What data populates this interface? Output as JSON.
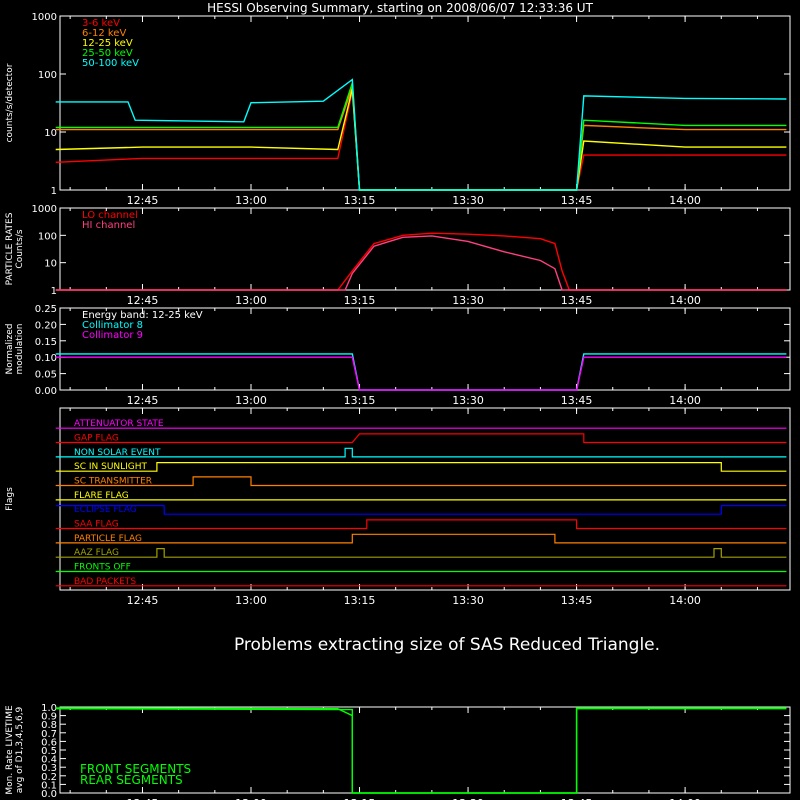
{
  "title": "HESSI Observing Summary, starting on 2008/06/07 12:33:36 UT",
  "message": "Problems extracting size of SAS Reduced Triangle.",
  "time_ticks": [
    "12:45",
    "13:00",
    "13:15",
    "13:30",
    "13:45",
    "14:00"
  ],
  "colors": {
    "background": "#000000",
    "axes": "#ffffff",
    "red": "#ff0000",
    "orange": "#ff8000",
    "yellow": "#ffff00",
    "green": "#00ff00",
    "cyan": "#00ffff",
    "magenta": "#ff00ff",
    "blue": "#0000ff",
    "pink": "#ff4080",
    "olive": "#a0a000"
  },
  "chart_data": [
    {
      "type": "line",
      "panel": "count-rates",
      "ylabel": "counts/s/detector",
      "ylog": true,
      "ylim": [
        1,
        1000
      ],
      "yticks": [
        "1",
        "10",
        "100",
        "1000"
      ],
      "x_unit": "UT",
      "series": [
        {
          "name": "3-6 keV",
          "color": "red",
          "points": [
            [
              "12:33",
              3
            ],
            [
              "12:45",
              3.5
            ],
            [
              "13:00",
              3.5
            ],
            [
              "13:12",
              3.5
            ],
            [
              "13:14",
              50
            ],
            [
              "13:15",
              1
            ],
            [
              "13:45",
              1
            ],
            [
              "13:46",
              4
            ],
            [
              "14:00",
              4
            ],
            [
              "14:14",
              4
            ]
          ]
        },
        {
          "name": "6-12 keV",
          "color": "orange",
          "points": [
            [
              "12:33",
              11
            ],
            [
              "12:45",
              11
            ],
            [
              "13:00",
              11
            ],
            [
              "13:12",
              11
            ],
            [
              "13:14",
              60
            ],
            [
              "13:15",
              1
            ],
            [
              "13:45",
              1
            ],
            [
              "13:46",
              13
            ],
            [
              "14:00",
              11
            ],
            [
              "14:14",
              11
            ]
          ]
        },
        {
          "name": "12-25 keV",
          "color": "yellow",
          "points": [
            [
              "12:33",
              5
            ],
            [
              "12:45",
              5.5
            ],
            [
              "13:00",
              5.5
            ],
            [
              "13:12",
              5
            ],
            [
              "13:14",
              55
            ],
            [
              "13:15",
              1
            ],
            [
              "13:45",
              1
            ],
            [
              "13:46",
              7
            ],
            [
              "14:00",
              5.5
            ],
            [
              "14:14",
              5.5
            ]
          ]
        },
        {
          "name": "25-50 keV",
          "color": "green",
          "points": [
            [
              "12:33",
              12
            ],
            [
              "12:45",
              12
            ],
            [
              "13:00",
              12
            ],
            [
              "13:12",
              12
            ],
            [
              "13:14",
              70
            ],
            [
              "13:15",
              1
            ],
            [
              "13:45",
              1
            ],
            [
              "13:46",
              16
            ],
            [
              "14:00",
              13
            ],
            [
              "14:14",
              13
            ]
          ]
        },
        {
          "name": "50-100 keV",
          "color": "cyan",
          "points": [
            [
              "12:33",
              33
            ],
            [
              "12:43",
              33
            ],
            [
              "12:44",
              16
            ],
            [
              "12:59",
              15
            ],
            [
              "13:00",
              32
            ],
            [
              "13:10",
              34
            ],
            [
              "13:14",
              80
            ],
            [
              "13:15",
              1
            ],
            [
              "13:45",
              1
            ],
            [
              "13:46",
              42
            ],
            [
              "14:00",
              38
            ],
            [
              "14:14",
              37
            ]
          ]
        }
      ]
    },
    {
      "type": "line",
      "panel": "particle-rates",
      "ylabel": [
        "PARTICLE RATES",
        "Counts/s"
      ],
      "ylog": true,
      "ylim": [
        1,
        1000
      ],
      "yticks": [
        "1",
        "10",
        "100",
        "1000"
      ],
      "series": [
        {
          "name": "LO channel",
          "color": "red",
          "points": [
            [
              "12:33",
              1
            ],
            [
              "13:12",
              1
            ],
            [
              "13:14",
              5
            ],
            [
              "13:17",
              50
            ],
            [
              "13:21",
              100
            ],
            [
              "13:25",
              120
            ],
            [
              "13:30",
              110
            ],
            [
              "13:35",
              95
            ],
            [
              "13:40",
              75
            ],
            [
              "13:42",
              50
            ],
            [
              "13:43",
              5
            ],
            [
              "13:44",
              1
            ],
            [
              "14:14",
              1
            ]
          ]
        },
        {
          "name": "HI channel",
          "color": "pink",
          "points": [
            [
              "12:33",
              1
            ],
            [
              "13:13",
              1
            ],
            [
              "13:14",
              4
            ],
            [
              "13:17",
              40
            ],
            [
              "13:21",
              85
            ],
            [
              "13:25",
              95
            ],
            [
              "13:30",
              60
            ],
            [
              "13:35",
              25
            ],
            [
              "13:40",
              12
            ],
            [
              "13:42",
              6
            ],
            [
              "13:43",
              1
            ],
            [
              "14:14",
              1
            ]
          ]
        }
      ]
    },
    {
      "type": "line",
      "panel": "modulation",
      "ylabel": [
        "Normalized",
        "modulation"
      ],
      "ylim": [
        0,
        0.25
      ],
      "yticks": [
        "0.00",
        "0.05",
        "0.10",
        "0.15",
        "0.20",
        "0.25"
      ],
      "annotation": "Energy band: 12-25 keV",
      "series": [
        {
          "name": "Collimator 8",
          "color": "cyan",
          "points": [
            [
              "12:33",
              0.11
            ],
            [
              "13:14",
              0.11
            ],
            [
              "13:15",
              0.0
            ],
            [
              "13:45",
              0.0
            ],
            [
              "13:46",
              0.11
            ],
            [
              "14:14",
              0.11
            ]
          ]
        },
        {
          "name": "Collimator 9",
          "color": "magenta",
          "points": [
            [
              "12:33",
              0.1
            ],
            [
              "13:14",
              0.1
            ],
            [
              "13:15",
              0.0
            ],
            [
              "13:45",
              0.0
            ],
            [
              "13:46",
              0.1
            ],
            [
              "14:14",
              0.1
            ]
          ]
        }
      ]
    },
    {
      "type": "line",
      "panel": "flags",
      "ylabel": "Flags",
      "series": [
        {
          "name": "ATTENUATOR STATE",
          "color": "magenta",
          "points": [
            [
              "12:33",
              0
            ],
            [
              "14:14",
              0
            ]
          ]
        },
        {
          "name": "GAP FLAG",
          "color": "red",
          "points": [
            [
              "12:33",
              0
            ],
            [
              "13:14",
              0
            ],
            [
              "13:15",
              1
            ],
            [
              "13:46",
              1
            ],
            [
              "13:46",
              0
            ],
            [
              "14:14",
              0
            ]
          ]
        },
        {
          "name": "NON SOLAR EVENT",
          "color": "cyan",
          "points": [
            [
              "12:33",
              0
            ],
            [
              "13:13",
              0
            ],
            [
              "13:13",
              1
            ],
            [
              "13:14",
              1
            ],
            [
              "13:14",
              0
            ],
            [
              "14:14",
              0
            ]
          ]
        },
        {
          "name": "SC IN SUNLIGHT",
          "color": "yellow",
          "points": [
            [
              "12:33",
              0
            ],
            [
              "12:47",
              0
            ],
            [
              "12:47",
              1
            ],
            [
              "14:05",
              1
            ],
            [
              "14:05",
              0
            ],
            [
              "14:14",
              0
            ]
          ]
        },
        {
          "name": "SC TRANSMITTER",
          "color": "orange",
          "points": [
            [
              "12:33",
              0
            ],
            [
              "12:52",
              0
            ],
            [
              "12:52",
              1
            ],
            [
              "13:00",
              1
            ],
            [
              "13:00",
              0
            ],
            [
              "14:14",
              0
            ]
          ]
        },
        {
          "name": "FLARE FLAG",
          "color": "yellow",
          "points": [
            [
              "12:33",
              0
            ],
            [
              "14:14",
              0
            ]
          ]
        },
        {
          "name": "ECLIPSE FLAG",
          "color": "blue",
          "points": [
            [
              "12:33",
              1
            ],
            [
              "12:48",
              1
            ],
            [
              "12:48",
              0
            ],
            [
              "14:05",
              0
            ],
            [
              "14:05",
              1
            ],
            [
              "14:14",
              1
            ]
          ]
        },
        {
          "name": "SAA FLAG",
          "color": "red",
          "points": [
            [
              "12:33",
              0
            ],
            [
              "13:16",
              0
            ],
            [
              "13:16",
              1
            ],
            [
              "13:45",
              1
            ],
            [
              "13:45",
              0
            ],
            [
              "14:14",
              0
            ]
          ]
        },
        {
          "name": "PARTICLE FLAG",
          "color": "orange",
          "points": [
            [
              "12:33",
              0
            ],
            [
              "13:14",
              0
            ],
            [
              "13:14",
              1
            ],
            [
              "13:42",
              1
            ],
            [
              "13:42",
              0
            ],
            [
              "14:14",
              0
            ]
          ]
        },
        {
          "name": "AAZ FLAG",
          "color": "olive",
          "points": [
            [
              "12:33",
              0
            ],
            [
              "12:47",
              0
            ],
            [
              "12:47",
              1
            ],
            [
              "12:48",
              1
            ],
            [
              "12:48",
              0
            ],
            [
              "14:04",
              0
            ],
            [
              "14:04",
              1
            ],
            [
              "14:05",
              1
            ],
            [
              "14:05",
              0
            ],
            [
              "14:14",
              0
            ]
          ]
        },
        {
          "name": "FRONTS OFF",
          "color": "green",
          "points": [
            [
              "12:33",
              0
            ],
            [
              "14:14",
              0
            ]
          ]
        },
        {
          "name": "BAD PACKETS",
          "color": "red",
          "points": [
            [
              "12:33",
              0
            ],
            [
              "14:14",
              0
            ]
          ]
        }
      ]
    },
    {
      "type": "line",
      "panel": "livetime",
      "ylabel": [
        "Mon. Rate LIVETIME",
        "avg of D1,3,4,5,6,9"
      ],
      "ylim": [
        0,
        1.0
      ],
      "yticks": [
        "0.0",
        "0.1",
        "0.2",
        "0.3",
        "0.4",
        "0.5",
        "0.6",
        "0.7",
        "0.8",
        "0.9",
        "1.0"
      ],
      "series": [
        {
          "name": "FRONT SEGMENTS",
          "color": "green",
          "points": [
            [
              "12:33",
              0.99
            ],
            [
              "13:12",
              0.98
            ],
            [
              "13:14",
              0.9
            ],
            [
              "13:14",
              0.0
            ],
            [
              "13:45",
              0.0
            ],
            [
              "13:45",
              0.99
            ],
            [
              "14:14",
              0.99
            ]
          ]
        },
        {
          "name": "REAR SEGMENTS",
          "color": "green",
          "points": [
            [
              "12:33",
              0.98
            ],
            [
              "13:14",
              0.97
            ],
            [
              "13:14",
              0.0
            ],
            [
              "13:45",
              0.0
            ],
            [
              "13:45",
              0.98
            ],
            [
              "14:14",
              0.98
            ]
          ]
        }
      ]
    }
  ]
}
